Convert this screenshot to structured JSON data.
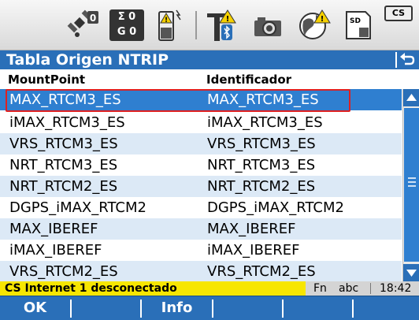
{
  "toolbar": {
    "icons": [
      "satellite-icon",
      "sigma-counter-icon",
      "battery-icon",
      "antenna-bluetooth-icon",
      "camera-icon",
      "globe-warning-icon",
      "sd-card-icon",
      "cs-icon"
    ],
    "satellites_count": "0",
    "sigma_top": "Σ 0",
    "sigma_bottom": "G 0",
    "sd_label": "SD",
    "cs_label": "CS"
  },
  "title": "Tabla Origen NTRIP",
  "columns": {
    "mountpoint": "MountPoint",
    "identifier": "Identificador"
  },
  "rows": [
    {
      "mountpoint": "MAX_RTCM3_ES",
      "identifier": "MAX_RTCM3_ES"
    },
    {
      "mountpoint": "iMAX_RTCM3_ES",
      "identifier": "iMAX_RTCM3_ES"
    },
    {
      "mountpoint": "VRS_RTCM3_ES",
      "identifier": "VRS_RTCM3_ES"
    },
    {
      "mountpoint": "NRT_RTCM3_ES",
      "identifier": "NRT_RTCM3_ES"
    },
    {
      "mountpoint": "NRT_RTCM2_ES",
      "identifier": "NRT_RTCM2_ES"
    },
    {
      "mountpoint": "DGPS_iMAX_RTCM2",
      "identifier": "DGPS_iMAX_RTCM2"
    },
    {
      "mountpoint": "MAX_IBEREF",
      "identifier": "MAX_IBEREF"
    },
    {
      "mountpoint": "iMAX_IBEREF",
      "identifier": "iMAX_IBEREF"
    },
    {
      "mountpoint": "VRS_RTCM2_ES",
      "identifier": "VRS_RTCM2_ES"
    }
  ],
  "status": {
    "message": "CS Internet 1 desconectado",
    "fn": "Fn",
    "input_mode": "abc",
    "time": "18:42"
  },
  "softkeys": [
    "OK",
    "",
    "Info",
    "",
    "",
    ""
  ],
  "colors": {
    "accent": "#2a6fb8",
    "selection": "#2f7fd0",
    "alt_row": "#dce9f6",
    "status_warning": "#f7e600",
    "highlight_border": "#e02020"
  }
}
